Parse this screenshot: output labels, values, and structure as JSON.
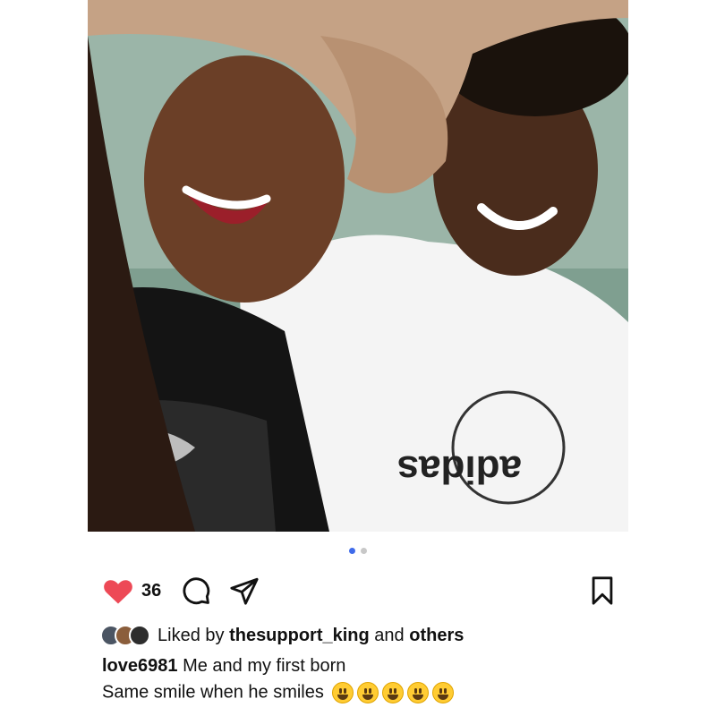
{
  "post": {
    "photo_alt": "",
    "carousel": {
      "total": 2,
      "active": 1
    },
    "like_count": "36",
    "liked_by_prefix": "Liked by",
    "liked_by_user": "thesupport_king",
    "liked_by_join": "and",
    "liked_by_others": "others",
    "caption_user": "love6981",
    "caption_line1": "Me and my first born",
    "caption_line2": "Same smile when he smiles",
    "emoji_count": 5
  },
  "icons": {
    "like": "heart-filled-icon",
    "comment": "comment-icon",
    "share": "send-icon",
    "save": "bookmark-icon"
  },
  "colors": {
    "heart": "#ed4956",
    "active_dot": "#3f6bea",
    "inactive_dot": "#c8c8c8",
    "text": "#111111"
  }
}
